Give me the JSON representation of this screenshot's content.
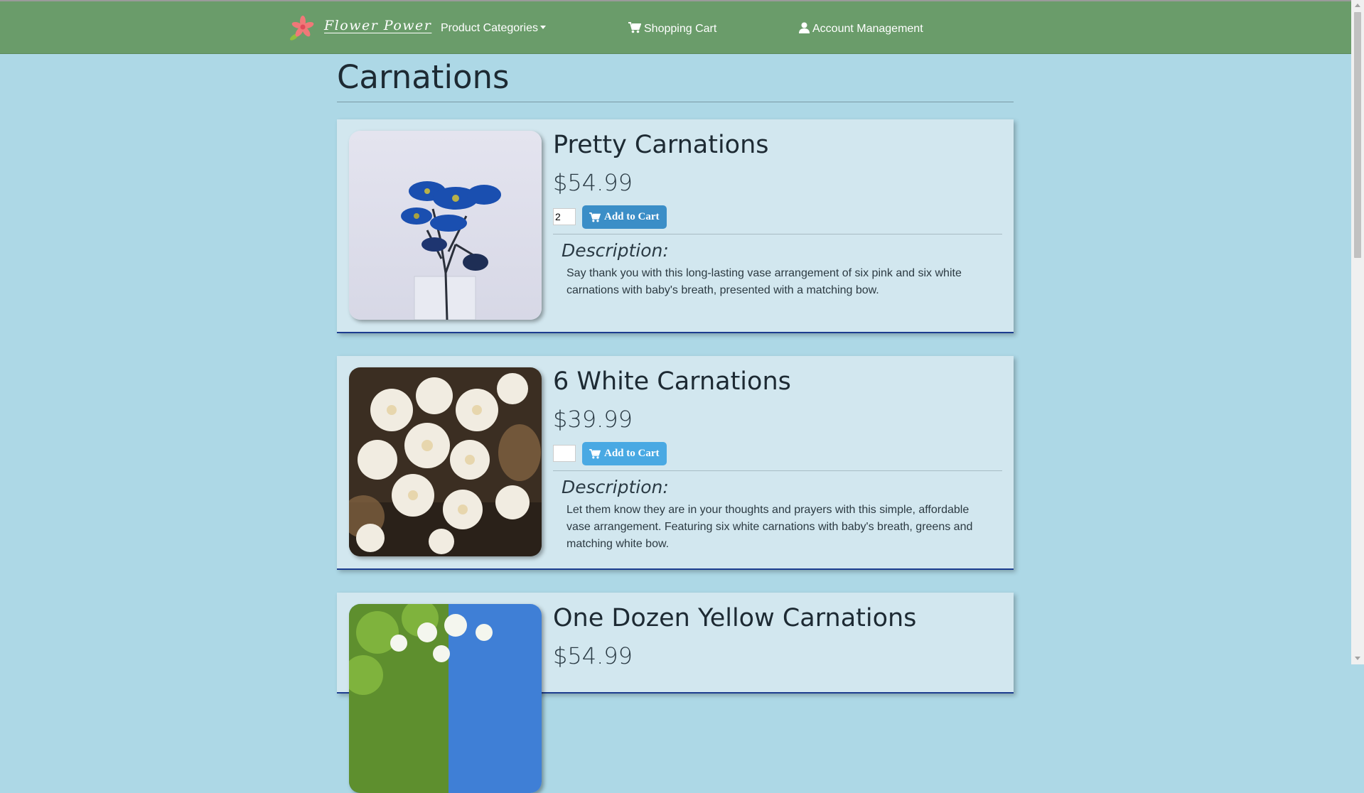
{
  "nav": {
    "brand": "Flower Power",
    "categories_label": "Product Categories",
    "cart_label": "Shopping Cart",
    "account_label": "Account Management"
  },
  "page": {
    "title": "Carnations"
  },
  "products": [
    {
      "name": "Pretty Carnations",
      "price": "$54.99",
      "quantity": "2",
      "button_label": "Add to Cart",
      "description_label": "Description:",
      "description": "Say thank you with this long-lasting vase arrangement of six pink and six white carnations with baby's breath, presented with a matching bow."
    },
    {
      "name": "6 White Carnations",
      "price": "$39.99",
      "quantity": "",
      "button_label": "Add to Cart",
      "description_label": "Description:",
      "description": "Let them know they are in your thoughts and prayers with this simple, affordable vase arrangement. Featuring six white carnations with baby's breath, greens and matching white bow."
    },
    {
      "name": "One Dozen Yellow Carnations",
      "price": "$54.99"
    }
  ],
  "colors": {
    "page_bg": "#add8e6",
    "navbar_bg": "#6a9c6a",
    "card_bg": "#d2e7ef",
    "card_border": "#1c3d8f",
    "button_blue": "#3b8ec7",
    "button_blue_light": "#49a9e3"
  },
  "icons": {
    "logo": "flower-logo-icon",
    "cart": "shopping-cart-icon",
    "account": "user-icon",
    "dropdown": "caret-down-icon"
  }
}
